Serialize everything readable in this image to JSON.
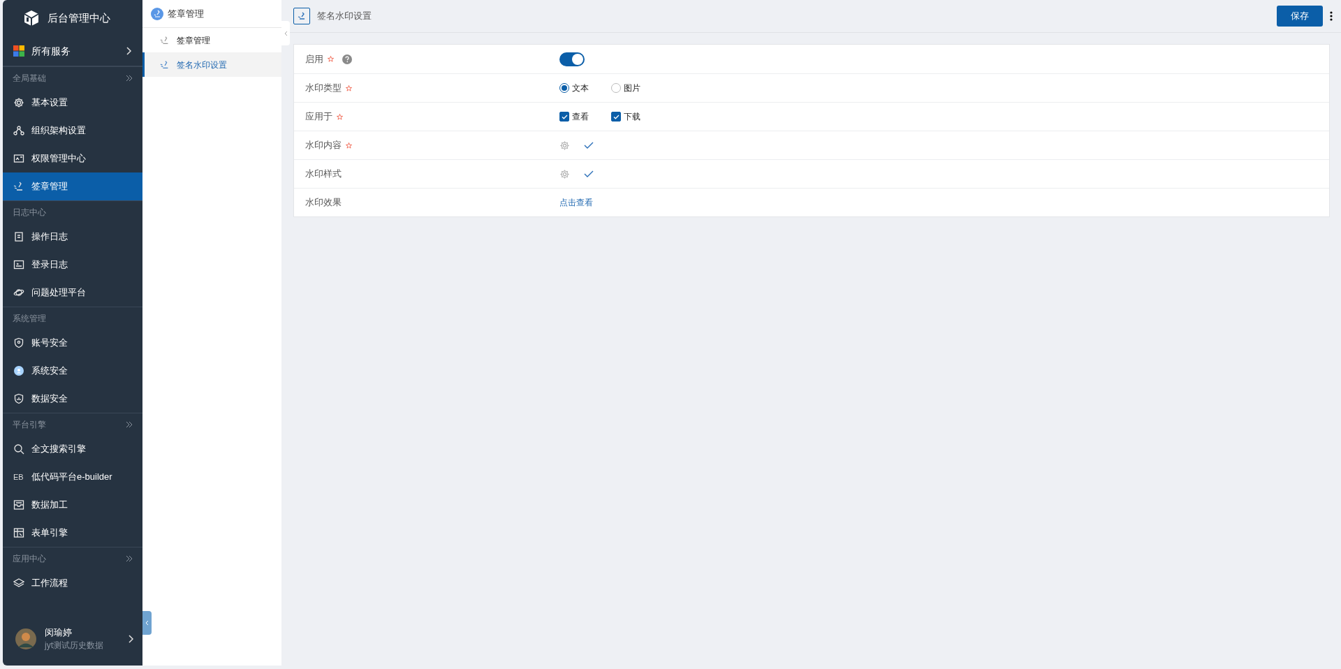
{
  "app": {
    "title": "后台管理中心"
  },
  "all_services": {
    "label": "所有服务"
  },
  "sidebar": {
    "items": [
      {
        "kind": "section",
        "label": "全局基础",
        "expandable": true
      },
      {
        "kind": "item",
        "label": "基本设置",
        "selected": false
      },
      {
        "kind": "item",
        "label": "组织架构设置",
        "selected": false
      },
      {
        "kind": "item",
        "label": "权限管理中心",
        "selected": false
      },
      {
        "kind": "item",
        "label": "签章管理",
        "selected": true
      },
      {
        "kind": "section",
        "label": "日志中心",
        "expandable": false
      },
      {
        "kind": "item",
        "label": "操作日志",
        "selected": false
      },
      {
        "kind": "item",
        "label": "登录日志",
        "selected": false
      },
      {
        "kind": "item",
        "label": "问题处理平台",
        "selected": false
      },
      {
        "kind": "section",
        "label": "系统管理",
        "expandable": false
      },
      {
        "kind": "item",
        "label": "账号安全",
        "selected": false
      },
      {
        "kind": "item",
        "label": "系统安全",
        "selected": false
      },
      {
        "kind": "item",
        "label": "数据安全",
        "selected": false
      },
      {
        "kind": "section",
        "label": "平台引擎",
        "expandable": true
      },
      {
        "kind": "item",
        "label": "全文搜索引擎",
        "selected": false
      },
      {
        "kind": "item",
        "label": "低代码平台e-builder",
        "selected": false,
        "icon_text": "EB"
      },
      {
        "kind": "item",
        "label": "数据加工",
        "selected": false
      },
      {
        "kind": "item",
        "label": "表单引擎",
        "selected": false
      },
      {
        "kind": "section",
        "label": "应用中心",
        "expandable": true
      },
      {
        "kind": "item",
        "label": "工作流程",
        "selected": false
      }
    ]
  },
  "user": {
    "name": "闵瑜婷",
    "org": "jyt测试历史数据"
  },
  "subnav": {
    "title": "签章管理",
    "items": [
      {
        "label": "签章管理",
        "selected": false
      },
      {
        "label": "签名水印设置",
        "selected": true
      }
    ]
  },
  "page": {
    "title": "签名水印设置",
    "save_button": "保存"
  },
  "form": {
    "rows": [
      {
        "label": "启用",
        "required": true,
        "help": true,
        "kind": "toggle",
        "on": true
      },
      {
        "label": "水印类型",
        "required": true,
        "help": false,
        "kind": "radio",
        "options": [
          {
            "label": "文本",
            "selected": true
          },
          {
            "label": "图片",
            "selected": false
          }
        ]
      },
      {
        "label": "应用于",
        "required": true,
        "help": false,
        "kind": "checkbox",
        "options": [
          {
            "label": "查看",
            "checked": true
          },
          {
            "label": "下载",
            "checked": true
          }
        ]
      },
      {
        "label": "水印内容",
        "required": true,
        "help": false,
        "kind": "settings"
      },
      {
        "label": "水印样式",
        "required": false,
        "help": false,
        "kind": "settings"
      },
      {
        "label": "水印效果",
        "required": false,
        "help": false,
        "kind": "link",
        "link": "点击查看"
      }
    ]
  }
}
